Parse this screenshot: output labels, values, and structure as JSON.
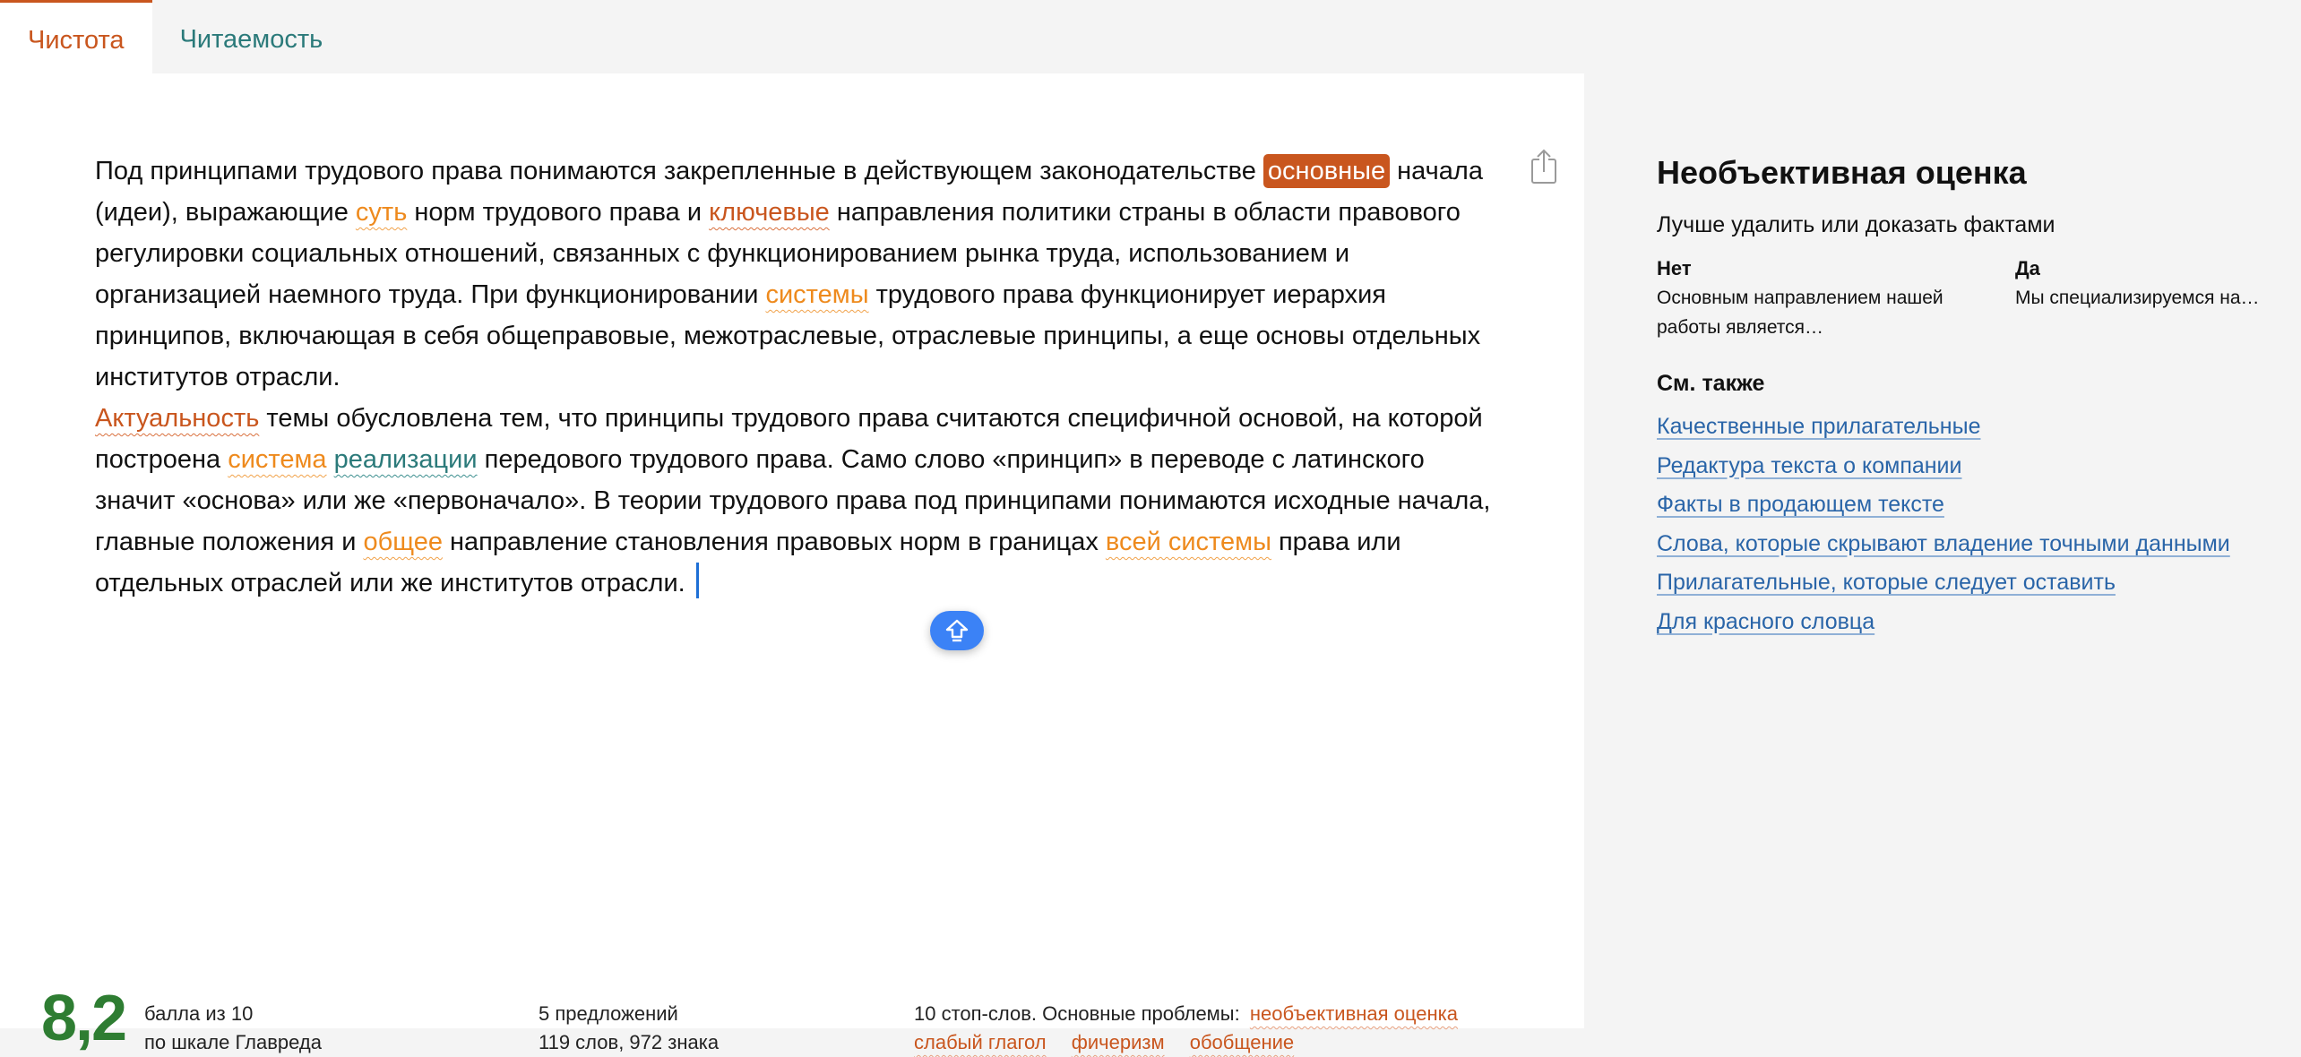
{
  "tabs": [
    "Чистота",
    "Читаемость"
  ],
  "text": {
    "p1": [
      {
        "t": "Под принципами трудового права понимаются закрепленные в действующем законодательстве "
      },
      {
        "t": "основные",
        "s": "sel"
      },
      {
        "t": " начала (идеи), выражающие "
      },
      {
        "t": "суть",
        "s": "y"
      },
      {
        "t": " норм трудового права и "
      },
      {
        "t": "ключевые",
        "s": "r"
      },
      {
        "t": " направления политики страны в области правового регулировки социальных отношений, связанных с функционированием рынка труда, использованием и организацией наемного труда. При функционировании "
      },
      {
        "t": "системы",
        "s": "y"
      },
      {
        "t": " трудового права функционирует иерархия принципов, включающая в себя общеправовые, межотраслевые, отраслевые принципы, а еще основы отдельных институтов отрасли."
      }
    ],
    "p2": [
      {
        "t": "Актуальность",
        "s": "r"
      },
      {
        "t": " темы обусловлена тем, что принципы трудового права считаются специфичной основой, на которой построена "
      },
      {
        "t": "система",
        "s": "y"
      },
      {
        "t": " "
      },
      {
        "t": "реализации",
        "s": "t"
      },
      {
        "t": " передового трудового права. Само слово «принцип» в переводе с латинского значит «основа» или же «первоначало». В теории трудового права под принципами понимаются исходные начала, главные положения и "
      },
      {
        "t": "общее",
        "s": "y"
      },
      {
        "t": " направление становления правовых норм в границах "
      },
      {
        "t": "всей системы",
        "s": "y"
      },
      {
        "t": " права или отдельных отраслей или же институтов отрасли. "
      }
    ]
  },
  "footer": {
    "score": "8,2",
    "score_line1": "балла из 10",
    "score_line2": "по шкале Главреда",
    "sentences": "5 предложений",
    "words": "119 слов, 972 знака",
    "problems_prefix": "10 стоп-слов. Основные проблемы:",
    "problems": [
      "необъективная оценка",
      "слабый глагол",
      "фичеризм",
      "обобщение"
    ]
  },
  "sidebar": {
    "title": "Необъективная оценка",
    "subtitle": "Лучше удалить или доказать фактами",
    "no_label": "Нет",
    "no_example": "Основным направлением нашей работы является…",
    "yes_label": "Да",
    "yes_example": "Мы специализируемся на…",
    "see_also": "См. также",
    "links": [
      "Качественные прилагательные",
      "Редактура текста о компании",
      "Факты в продающем тексте",
      "Слова, которые скрывают владение точными данными",
      "Прилагательные, которые следует оставить",
      "Для красного словца"
    ]
  },
  "colors": {
    "accent": "#c9561e",
    "warning": "#ee8a1d",
    "teal": "#2b7a7a",
    "score": "#2e7d32",
    "button": "#3b82f6"
  },
  "icons": {
    "share": "share-icon",
    "up": "arrow-up-icon"
  }
}
